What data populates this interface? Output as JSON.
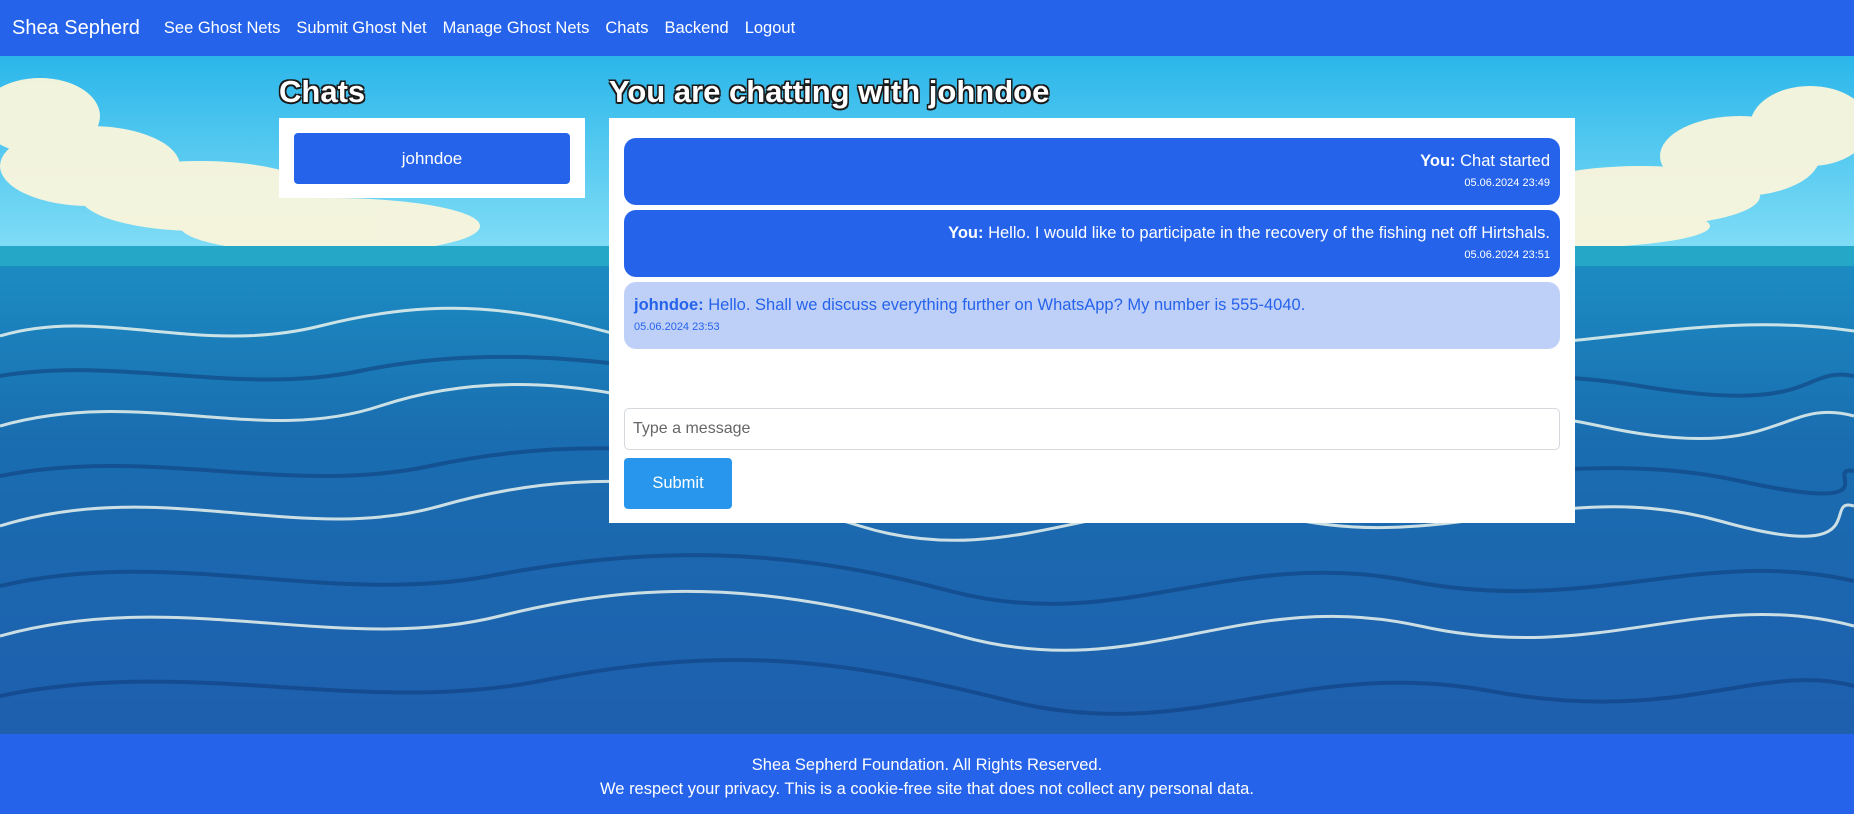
{
  "navbar": {
    "brand": "Shea Sepherd",
    "links": [
      "See Ghost Nets",
      "Submit Ghost Net",
      "Manage Ghost Nets",
      "Chats",
      "Backend",
      "Logout"
    ]
  },
  "sidebar": {
    "title": "Chats",
    "chats": [
      "johndoe"
    ]
  },
  "conversation": {
    "title": "You are chatting with johndoe",
    "messages": [
      {
        "sender": "You:",
        "text": "Chat started",
        "time": "05.06.2024 23:49",
        "own": true
      },
      {
        "sender": "You:",
        "text": "Hello. I would like to participate in the recovery of the fishing net off Hirtshals.",
        "time": "05.06.2024 23:51",
        "own": true
      },
      {
        "sender": "johndoe:",
        "text": "Hello. Shall we discuss everything further on WhatsApp? My number is 555-4040.",
        "time": "05.06.2024 23:53",
        "own": false
      }
    ]
  },
  "composer": {
    "placeholder": "Type a message",
    "value": "",
    "submit_label": "Submit"
  },
  "footer": {
    "line1": "Shea Sepherd Foundation. All Rights Reserved.",
    "line2": "We respect your privacy. This is a cookie-free site that does not collect any personal data."
  },
  "colors": {
    "primary": "#2563eb",
    "submit": "#2796ec",
    "received_bubble": "#bfd0f8",
    "panel": "#ffffff"
  }
}
